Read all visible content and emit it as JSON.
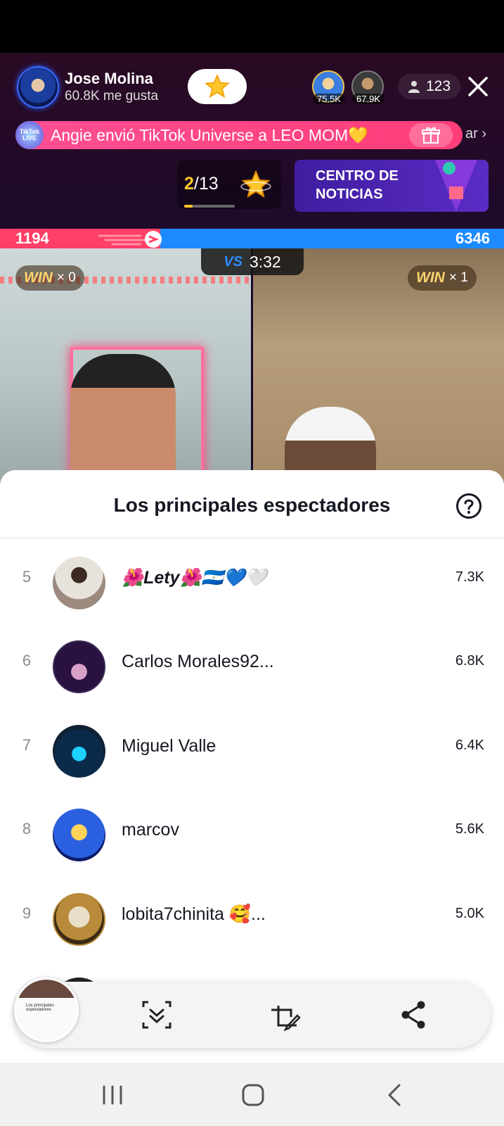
{
  "live": {
    "host_name": "Jose Molina",
    "host_likes": "60.8K me gusta",
    "top_viewers": [
      {
        "count": "75.5K"
      },
      {
        "count": "67.9K"
      }
    ],
    "viewer_count": "123",
    "gift_banner": {
      "logo_text": "TikTok LIVE",
      "message": "Angie envió TikTok Universe a LEO MOM💛",
      "trailing": "ar"
    },
    "ranking": {
      "current": "2",
      "total": "/13",
      "progress": 0.16
    },
    "news_label": "CENTRO DE NOTICIAS",
    "battle": {
      "left_score": "1194",
      "right_score": "6346",
      "timer": "3:32",
      "vs": "VS",
      "left_win_label": "WIN",
      "left_win_count": "× 0",
      "right_win_label": "WIN",
      "right_win_count": "× 1"
    }
  },
  "sheet": {
    "title": "Los principales espectadores",
    "rows": [
      {
        "rank": "5",
        "name": "🌺Lety🌺🇳🇮💙🤍",
        "score": "7.3K"
      },
      {
        "rank": "6",
        "name": "Carlos Morales92...",
        "score": "6.8K"
      },
      {
        "rank": "7",
        "name": "Miguel Valle",
        "score": "6.4K"
      },
      {
        "rank": "8",
        "name": "marcov",
        "score": "5.6K"
      },
      {
        "rank": "9",
        "name": "lobita7chinita 🥰...",
        "score": "5.0K"
      }
    ]
  },
  "toolbar": {
    "thumbnail_caption": "Los principales espectadores",
    "icons": [
      "scroll-capture-icon",
      "edit-screenshot-icon",
      "share-icon"
    ]
  },
  "navbar": {
    "icons": [
      "recent-apps-icon",
      "home-icon",
      "back-icon"
    ]
  },
  "colors": {
    "accent_pink": "#ff3f66",
    "accent_blue": "#1d8bff",
    "gold": "#ffc62b"
  }
}
